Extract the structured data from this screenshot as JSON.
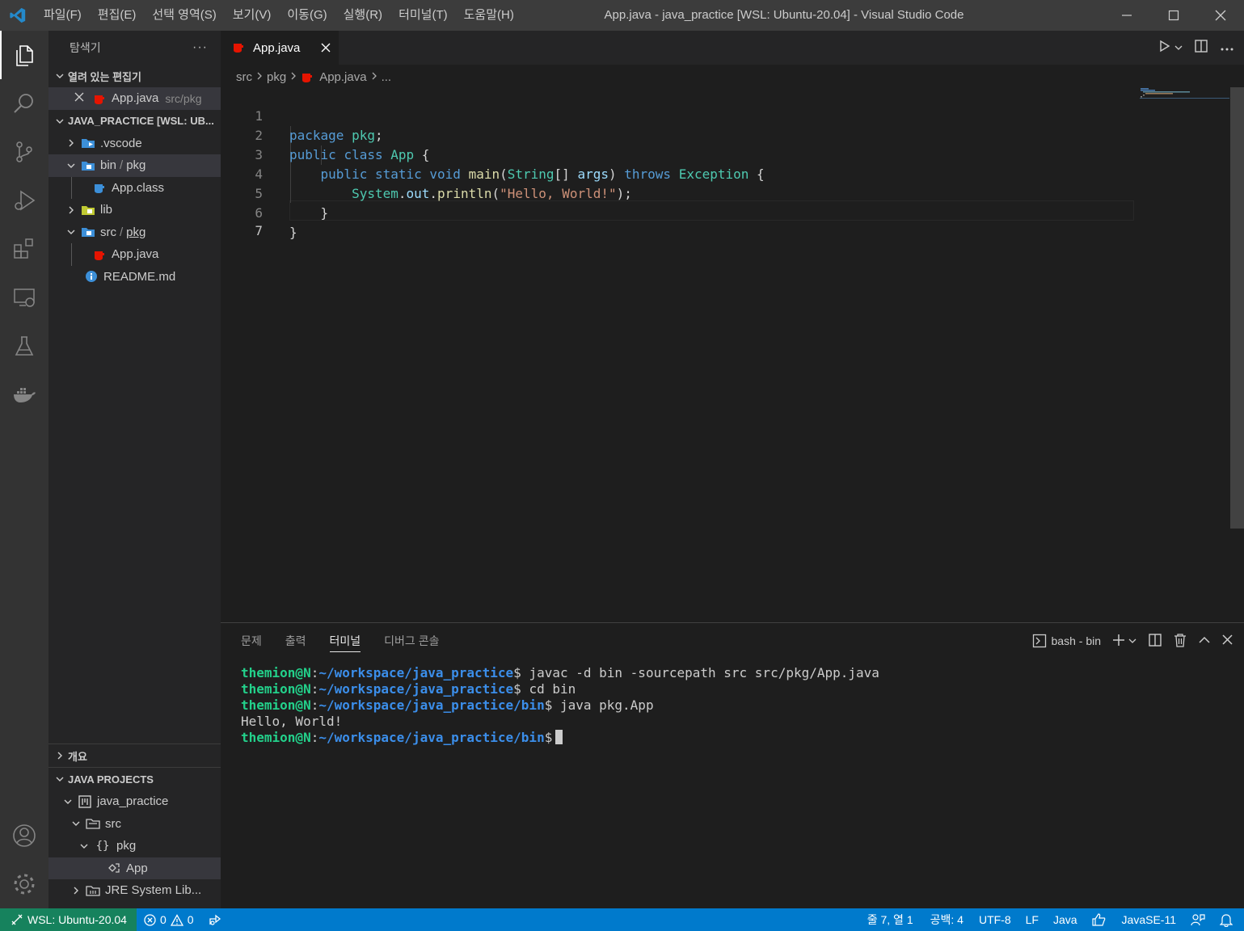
{
  "titlebar": {
    "menu": [
      "파일(F)",
      "편집(E)",
      "선택 영역(S)",
      "보기(V)",
      "이동(G)",
      "실행(R)",
      "터미널(T)",
      "도움말(H)"
    ],
    "window_title": "App.java - java_practice [WSL: Ubuntu-20.04] - Visual Studio Code"
  },
  "sidebar": {
    "title": "탐색기",
    "more": "···",
    "open_editors": {
      "header": "열려 있는 편집기",
      "items": [
        {
          "name": "App.java",
          "path": "src/pkg"
        }
      ]
    },
    "workspace": {
      "header": "JAVA_PRACTICE [WSL: UB...",
      "items": [
        {
          "label": ".vscode"
        },
        {
          "label": "bin",
          "sep": "/",
          "label2": "pkg"
        },
        {
          "label": "App.class"
        },
        {
          "label": "lib"
        },
        {
          "label": "src",
          "sep": "/",
          "label2": "pkg"
        },
        {
          "label": "App.java"
        },
        {
          "label": "README.md"
        }
      ]
    },
    "outline": {
      "header": "개요"
    },
    "java_projects": {
      "header": "JAVA PROJECTS",
      "items": [
        {
          "label": "java_practice"
        },
        {
          "label": "src"
        },
        {
          "label": "pkg"
        },
        {
          "label": "App"
        },
        {
          "label": "JRE System Lib..."
        }
      ]
    }
  },
  "editor": {
    "tab_label": "App.java",
    "breadcrumb": {
      "parts": [
        "src",
        "pkg",
        "App.java",
        "..."
      ]
    },
    "line_numbers": [
      "1",
      "2",
      "3",
      "4",
      "5",
      "6",
      "7"
    ],
    "code": {
      "l1": {
        "kw": "package",
        "name": "pkg",
        "end": ";"
      },
      "l2": {
        "kw1": "public",
        "kw2": "class",
        "name": "App",
        "end": " {"
      },
      "l3": {
        "kw1": "public",
        "kw2": "static",
        "kw3": "void",
        "fn": "main",
        "p1": "(",
        "type": "String",
        "p2": "[] ",
        "arg": "args",
        "p3": ") ",
        "kw4": "throws",
        "ex": "Exception",
        "end": " {"
      },
      "l4": {
        "cls": "System",
        "dot1": ".",
        "fld": "out",
        "dot2": ".",
        "fn": "println",
        "p1": "(",
        "str": "\"Hello, World!\"",
        "end": ");"
      },
      "l5": "}",
      "l6": "}"
    }
  },
  "panel": {
    "tabs": [
      "문제",
      "출력",
      "터미널",
      "디버그 콘솔"
    ],
    "active_tab": "터미널",
    "terminal_name": "bash - bin",
    "terminal": [
      {
        "user": "themion@N",
        "colon": ":",
        "path": "~/workspace/java_practice",
        "dollar": "$",
        "cmd": " javac -d bin -sourcepath src src/pkg/App.java"
      },
      {
        "user": "themion@N",
        "colon": ":",
        "path": "~/workspace/java_practice",
        "dollar": "$",
        "cmd": " cd bin"
      },
      {
        "user": "themion@N",
        "colon": ":",
        "path": "~/workspace/java_practice/bin",
        "dollar": "$",
        "cmd": " java pkg.App"
      },
      {
        "output": "Hello, World!"
      },
      {
        "user": "themion@N",
        "colon": ":",
        "path": "~/workspace/java_practice/bin",
        "dollar": "$",
        "cmd": " "
      }
    ]
  },
  "statusbar": {
    "remote": "WSL: Ubuntu-20.04",
    "errors": "0",
    "warnings": "0",
    "position": "줄 7, 열 1",
    "spaces": "공백: 4",
    "encoding": "UTF-8",
    "eol": "LF",
    "language": "Java",
    "java_version": "JavaSE-11"
  },
  "colors": {
    "accent": "#007acc",
    "remote": "#16825d",
    "java_icon": "#e51400",
    "folder_blue": "#3c8fd8",
    "terminal_user": "#23d18b",
    "terminal_path": "#3b8eea"
  }
}
